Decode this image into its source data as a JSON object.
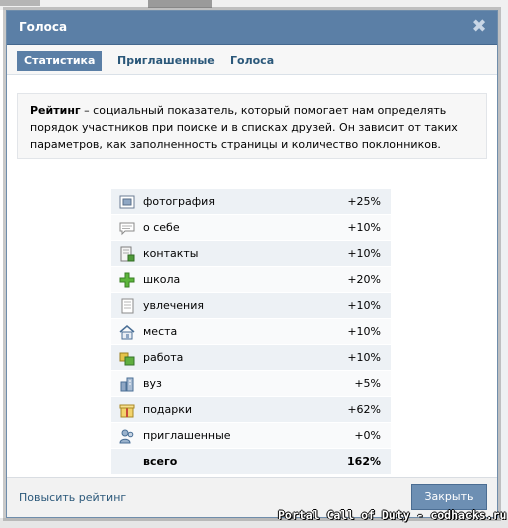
{
  "dialog": {
    "title": "Голоса",
    "close_glyph": "✖"
  },
  "tabs": [
    {
      "label": "Статистика",
      "active": true
    },
    {
      "label": "Приглашенные",
      "active": false
    },
    {
      "label": "Голоса",
      "active": false
    }
  ],
  "info": {
    "term": "Рейтинг",
    "text": " – социальный показатель, который помогает нам определять порядок участников при поиске и в списках друзей. Он зависит от таких параметров, как заполненность страницы и количество поклонников."
  },
  "rating_rows": [
    {
      "label": "фотография",
      "value": "+25%",
      "icon": "photo-icon"
    },
    {
      "label": "о себе",
      "value": "+10%",
      "icon": "speech-bubble-icon"
    },
    {
      "label": "контакты",
      "value": "+10%",
      "icon": "contacts-icon"
    },
    {
      "label": "школа",
      "value": "+20%",
      "icon": "plus-cross-icon"
    },
    {
      "label": "увлечения",
      "value": "+10%",
      "icon": "notes-icon"
    },
    {
      "label": "места",
      "value": "+10%",
      "icon": "house-icon"
    },
    {
      "label": "работа",
      "value": "+10%",
      "icon": "work-icon"
    },
    {
      "label": "вуз",
      "value": "+5%",
      "icon": "university-icon"
    },
    {
      "label": "подарки",
      "value": "+62%",
      "icon": "gift-icon"
    },
    {
      "label": "приглашенные",
      "value": "+0%",
      "icon": "invited-users-icon"
    }
  ],
  "total": {
    "label": "всего",
    "value": "162%"
  },
  "footer": {
    "improve_link": "Повысить рейтинг",
    "close_button": "Закрыть"
  },
  "watermark": "Portal Call of Duty - codhacks.ru"
}
